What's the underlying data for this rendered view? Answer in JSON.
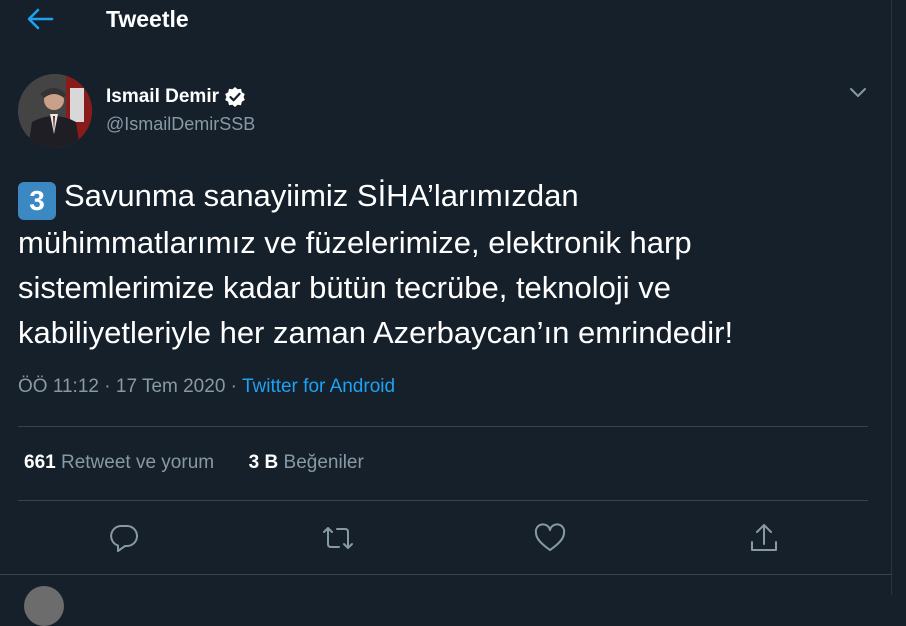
{
  "header": {
    "title": "Tweetle",
    "back_icon": "arrow-left-icon"
  },
  "colors": {
    "background": "#15202b",
    "accent": "#1da1f2",
    "muted": "#8899a6",
    "divider": "#38444d"
  },
  "author": {
    "name": "Ismail Demir",
    "handle": "@IsmailDemirSSB",
    "verified_icon": "verified-badge-icon",
    "menu_icon": "chevron-down-icon"
  },
  "tweet": {
    "number_emoji": "3",
    "line1": "Savunma sanayiimiz SİHA’larımızdan",
    "line2": "mühimmatlarımız ve füzelerimize, elektronik harp",
    "line3": "sistemlerimize kadar bütün tecrübe, teknoloji ve",
    "line4": "kabiliyetleriyle her zaman Azerbaycan’ın emrindedir!"
  },
  "meta": {
    "time": "ÖÖ 11:12",
    "dot1": " · ",
    "date": "17 Tem 2020",
    "dot2": " · ",
    "source": "Twitter for Android"
  },
  "stats": {
    "retweets_count": "661",
    "retweets_label": " Retweet ve yorum",
    "likes_count": "3 B",
    "likes_label": " Beğeniler"
  },
  "actions": {
    "reply_icon": "reply-icon",
    "retweet_icon": "retweet-icon",
    "like_icon": "heart-icon",
    "share_icon": "share-icon"
  }
}
